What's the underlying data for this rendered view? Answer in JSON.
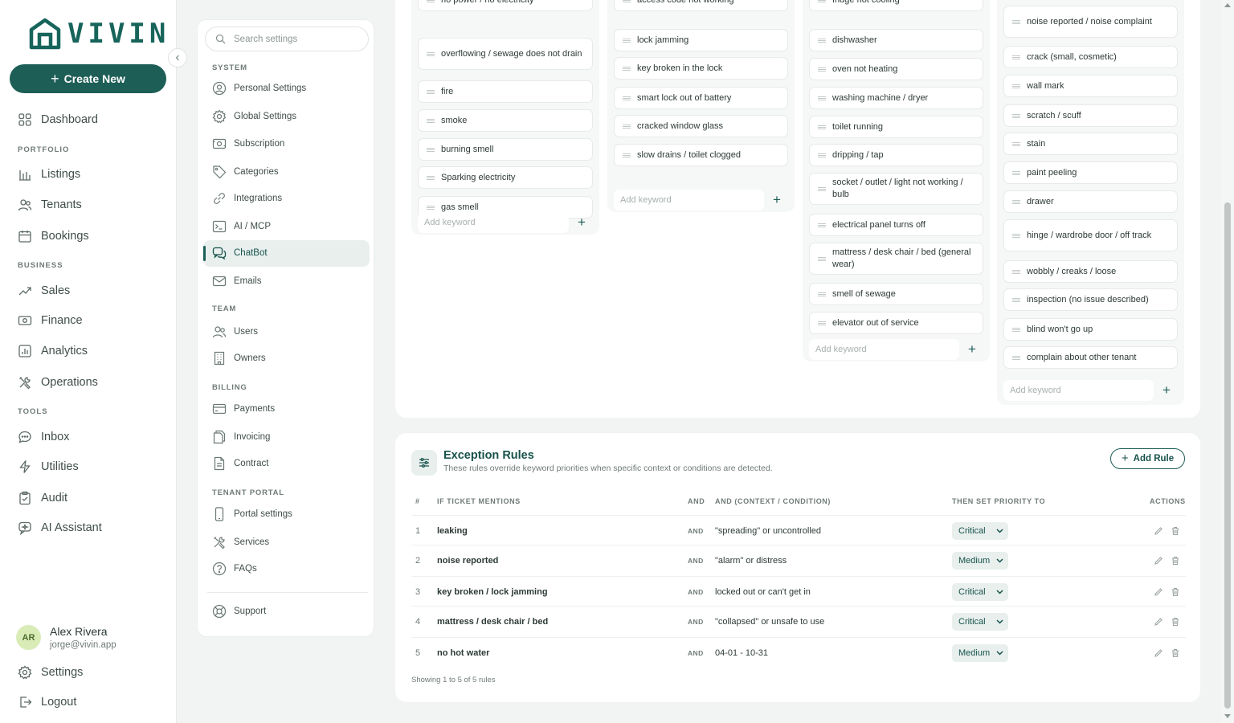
{
  "brand": {
    "name": "VIVIN",
    "color": "#1d5e56"
  },
  "create_button": "Create New",
  "nav": {
    "dashboard": "Dashboard",
    "portfolio_section": "PORTFOLIO",
    "listings": "Listings",
    "tenants": "Tenants",
    "bookings": "Bookings",
    "business_section": "BUSINESS",
    "sales": "Sales",
    "finance": "Finance",
    "analytics": "Analytics",
    "operations": "Operations",
    "tools_section": "TOOLS",
    "inbox": "Inbox",
    "utilities": "Utilities",
    "audit": "Audit",
    "ai_assistant": "AI Assistant",
    "settings": "Settings",
    "logout": "Logout"
  },
  "user": {
    "initials": "AR",
    "name": "Alex Rivera",
    "email": "jorge@vivin.app"
  },
  "settings_panel": {
    "search_placeholder": "Search settings",
    "system_section": "SYSTEM",
    "personal_settings": "Personal Settings",
    "global_settings": "Global Settings",
    "subscription": "Subscription",
    "categories": "Categories",
    "integrations": "Integrations",
    "ai_mcp": "AI / MCP",
    "chatbot": "ChatBot",
    "emails": "Emails",
    "team_section": "TEAM",
    "users": "Users",
    "owners": "Owners",
    "billing_section": "BILLING",
    "payments": "Payments",
    "invoicing": "Invoicing",
    "contract": "Contract",
    "tenant_portal_section": "TENANT PORTAL",
    "portal_settings": "Portal settings",
    "services": "Services",
    "faqs": "FAQs",
    "support": "Support",
    "active_item": "ChatBot"
  },
  "keyword_columns": [
    {
      "keywords": [
        "no power / no electricity",
        "overflowing / sewage does not drain",
        "fire",
        "smoke",
        "burning smell",
        "Sparking electricity",
        "gas smell"
      ],
      "add_placeholder": "Add keyword"
    },
    {
      "keywords": [
        "access code not working",
        "lock jamming",
        "key broken in the lock",
        "smart lock out of battery",
        "cracked window glass",
        "slow drains / toilet clogged"
      ],
      "add_placeholder": "Add keyword"
    },
    {
      "keywords": [
        "fridge not cooling",
        "dishwasher",
        "oven not heating",
        "washing machine / dryer",
        "toilet running",
        "dripping / tap",
        "socket / outlet / light not working / bulb",
        "electrical panel turns off",
        "mattress / desk chair / bed (general wear)",
        "smell of sewage",
        "elevator out of service"
      ],
      "add_placeholder": "Add keyword"
    },
    {
      "keywords": [
        "noise reported / noise complaint",
        "crack (small, cosmetic)",
        "wall mark",
        "scratch / scuff",
        "stain",
        "paint peeling",
        "drawer",
        "hinge / wardrobe door / off track",
        "wobbly / creaks / loose",
        "inspection (no issue described)",
        "blind won't go up",
        "complain about other tenant"
      ],
      "add_placeholder": "Add keyword"
    }
  ],
  "exception_rules": {
    "title": "Exception Rules",
    "subtitle": "These rules override keyword priorities when specific context or conditions are detected.",
    "add_button": "Add Rule",
    "headers": {
      "num": "#",
      "mention": "IF TICKET MENTIONS",
      "and": "AND",
      "condition": "AND (CONTEXT / CONDITION)",
      "priority": "THEN SET PRIORITY TO",
      "actions": "ACTIONS"
    },
    "rows": [
      {
        "num": "1",
        "mention": "leaking",
        "and": "AND",
        "condition": "\"spreading\" or uncontrolled",
        "priority": "Critical"
      },
      {
        "num": "2",
        "mention": "noise reported",
        "and": "AND",
        "condition": "\"alarm\" or distress",
        "priority": "Medium"
      },
      {
        "num": "3",
        "mention": "key broken / lock jamming",
        "and": "AND",
        "condition": "locked out or can't get in",
        "priority": "Critical"
      },
      {
        "num": "4",
        "mention": "mattress / desk chair / bed",
        "and": "AND",
        "condition": "\"collapsed\" or unsafe to use",
        "priority": "Critical"
      },
      {
        "num": "5",
        "mention": "no hot water",
        "and": "AND",
        "condition": "04-01 - 10-31",
        "priority": "Medium"
      }
    ],
    "footer": "Showing 1 to 5 of 5 rules"
  }
}
